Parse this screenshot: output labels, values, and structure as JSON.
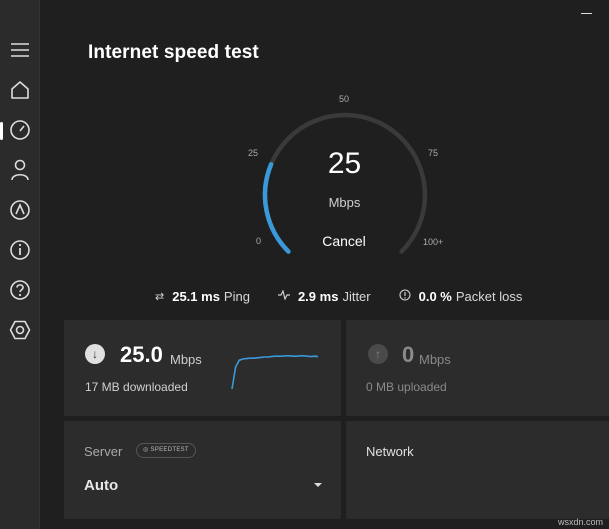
{
  "window": {
    "minimize": "minimize"
  },
  "sidebar": {
    "items": [
      {
        "icon": "menu-icon"
      },
      {
        "icon": "home-icon"
      },
      {
        "icon": "speedometer-icon",
        "active": true
      },
      {
        "icon": "person-icon"
      },
      {
        "icon": "chevron-up-icon"
      },
      {
        "icon": "info-icon"
      },
      {
        "icon": "help-icon"
      },
      {
        "icon": "settings-icon"
      }
    ]
  },
  "page": {
    "title": "Internet speed test"
  },
  "gauge": {
    "value": "25",
    "unit": "Mbps",
    "cancel_label": "Cancel",
    "ticks": {
      "t0": "0",
      "t25": "25",
      "t50": "50",
      "t75": "75",
      "t100": "100+"
    },
    "fill_fraction": 0.25,
    "accent_color": "#3a9ad9"
  },
  "stats": {
    "ping": {
      "value": "25.1 ms",
      "label": "Ping"
    },
    "jitter": {
      "value": "2.9 ms",
      "label": "Jitter"
    },
    "loss": {
      "value": "0.0 %",
      "label": "Packet loss"
    }
  },
  "download": {
    "value": "25.0",
    "unit": "Mbps",
    "sub": "17 MB downloaded",
    "history": [
      0,
      55,
      72,
      75,
      76,
      77,
      77,
      78,
      79,
      80,
      80,
      81,
      82,
      82,
      82,
      83,
      83,
      82,
      82,
      83,
      83,
      82,
      81,
      82,
      81
    ]
  },
  "upload": {
    "value": "0",
    "unit": "Mbps",
    "sub": "0 MB uploaded"
  },
  "server": {
    "label": "Server",
    "brand": "SPEEDTEST",
    "selected": "Auto"
  },
  "network": {
    "label": "Network"
  },
  "watermark": "wsxdn.com"
}
